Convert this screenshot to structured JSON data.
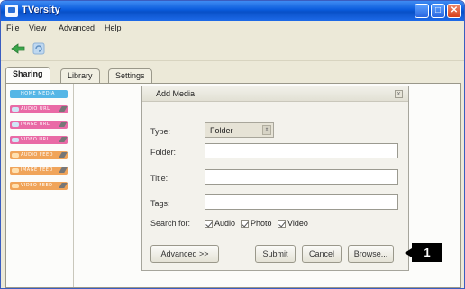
{
  "app": {
    "title": "TVersity"
  },
  "window_controls": {
    "minimize": "_",
    "maximize": "□",
    "close": "✕"
  },
  "menu": [
    "File",
    "View",
    "Advanced",
    "Help"
  ],
  "toolbar": {
    "icons": [
      "add-icon",
      "refresh-icon"
    ]
  },
  "tabs": [
    "Sharing",
    "Library",
    "Settings"
  ],
  "sidebar": {
    "items": [
      {
        "label": "HOME  MEDIA",
        "color": "#55b6e6",
        "icon": "home-icon"
      },
      {
        "label": "AUDIO URL",
        "color": "#e96aa6",
        "icon": "link-icon"
      },
      {
        "label": "IMAGE URL",
        "color": "#e96aa6",
        "icon": "link-icon"
      },
      {
        "label": "VIDEO URL",
        "color": "#e96aa6",
        "icon": "link-icon"
      },
      {
        "label": "AUDIO FEED",
        "color": "#f0a45a",
        "icon": "feed-icon"
      },
      {
        "label": "IMAGE FEED",
        "color": "#f0a45a",
        "icon": "feed-icon"
      },
      {
        "label": "VIDEO FEED",
        "color": "#f0a45a",
        "icon": "feed-icon"
      }
    ]
  },
  "dialog": {
    "title": "Add Media",
    "close": "x",
    "type_label": "Type:",
    "type_value": "Folder",
    "folder_label": "Folder:",
    "title_label": "Title:",
    "tags_label": "Tags:",
    "search_label": "Search for:",
    "checkboxes": [
      {
        "label": "Audio",
        "checked": true
      },
      {
        "label": "Photo",
        "checked": true
      },
      {
        "label": "Video",
        "checked": true
      }
    ],
    "buttons": {
      "advanced": "Advanced >>",
      "submit": "Submit",
      "cancel": "Cancel",
      "browse": "Browse..."
    }
  },
  "callout": {
    "label": "1"
  }
}
